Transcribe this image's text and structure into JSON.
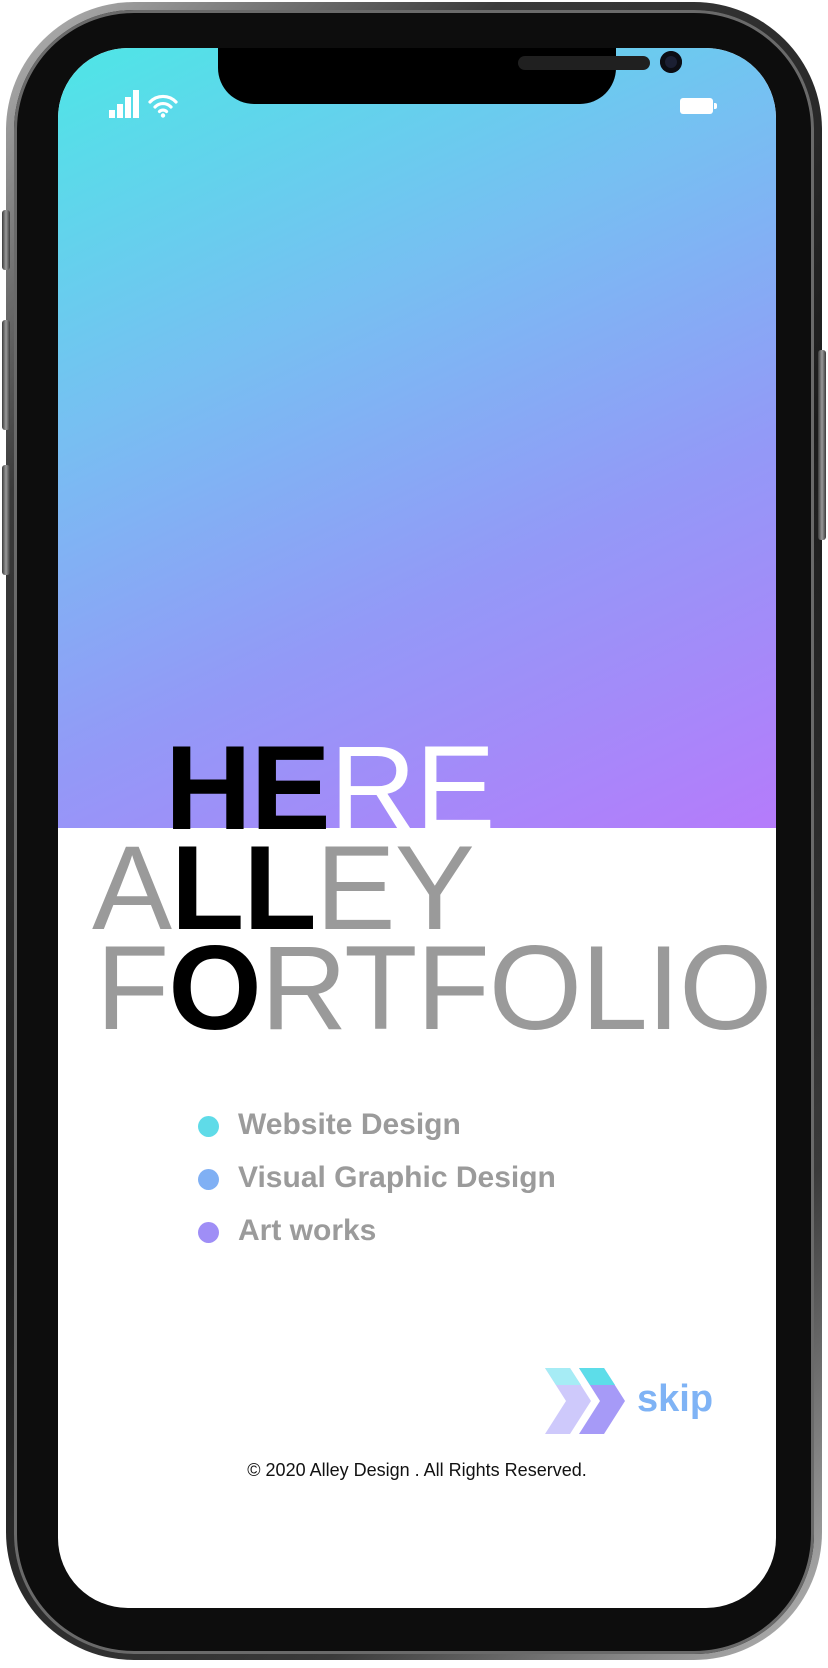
{
  "colors": {
    "gradient_start": "#4ee6e6",
    "gradient_end": "#b57bfb",
    "service_dots": [
      "#5fdbe8",
      "#80b0f4",
      "#9f8ef6"
    ],
    "skip_accent": "#7fb3f5"
  },
  "status_bar": {
    "icons": [
      "signal-icon",
      "wifi-icon",
      "battery-icon"
    ]
  },
  "headline": {
    "line1": {
      "bold": "HE",
      "light": "RE"
    },
    "line2": {
      "light_a": "A",
      "bold": "LL",
      "light_b": "EY"
    },
    "line3": {
      "light_a": "F",
      "bold": "O",
      "light_b": "RTFOLIO"
    }
  },
  "services": [
    {
      "label": "Website Design"
    },
    {
      "label": "Visual Graphic Design"
    },
    {
      "label": "Art works"
    }
  ],
  "skip": {
    "label": "skip",
    "icon": "double-chevron-right-icon"
  },
  "footer": {
    "copyright": "© 2020 Alley Design . All Rights Reserved."
  }
}
